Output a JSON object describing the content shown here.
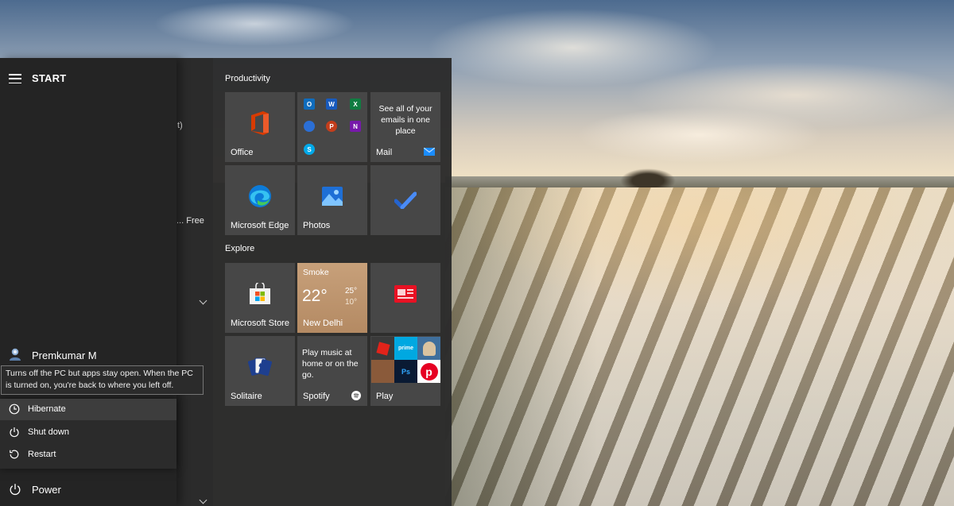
{
  "start": {
    "title": "START",
    "hamburger": "menu-icon",
    "partial_list": {
      "paren": "t)",
      "dots_free": "...  Free"
    }
  },
  "user": {
    "name": "Premkumar M"
  },
  "power_menu": {
    "tooltip": "Turns off the PC but apps stay open. When the PC is turned on, you're back to where you left off.",
    "items": [
      {
        "label": "Hibernate",
        "icon": "clock-icon"
      },
      {
        "label": "Shut down",
        "icon": "power-icon"
      },
      {
        "label": "Restart",
        "icon": "restart-icon"
      }
    ],
    "power_label": "Power"
  },
  "groups": {
    "productivity": {
      "title": "Productivity",
      "tiles": {
        "office": "Office",
        "mail_promo": "See all of your emails in one place",
        "mail": "Mail",
        "edge": "Microsoft Edge",
        "photos": "Photos"
      }
    },
    "explore": {
      "title": "Explore",
      "tiles": {
        "store": "Microsoft Store",
        "weather": {
          "condition": "Smoke",
          "temp": "22°",
          "high": "25°",
          "low": "10°",
          "city": "New Delhi"
        },
        "solitaire": "Solitaire",
        "spotify_promo": "Play music at home or on the go.",
        "spotify": "Spotify",
        "play": "Play"
      }
    }
  },
  "colors": {
    "menu_bg": "#2b2b2b",
    "nav_bg": "#242424",
    "tile_bg": "#474747",
    "weather_tile": "#c7a07a",
    "office_red": "#d83b01",
    "todo_blue": "#2564cf",
    "pinterest_red": "#e60023"
  }
}
